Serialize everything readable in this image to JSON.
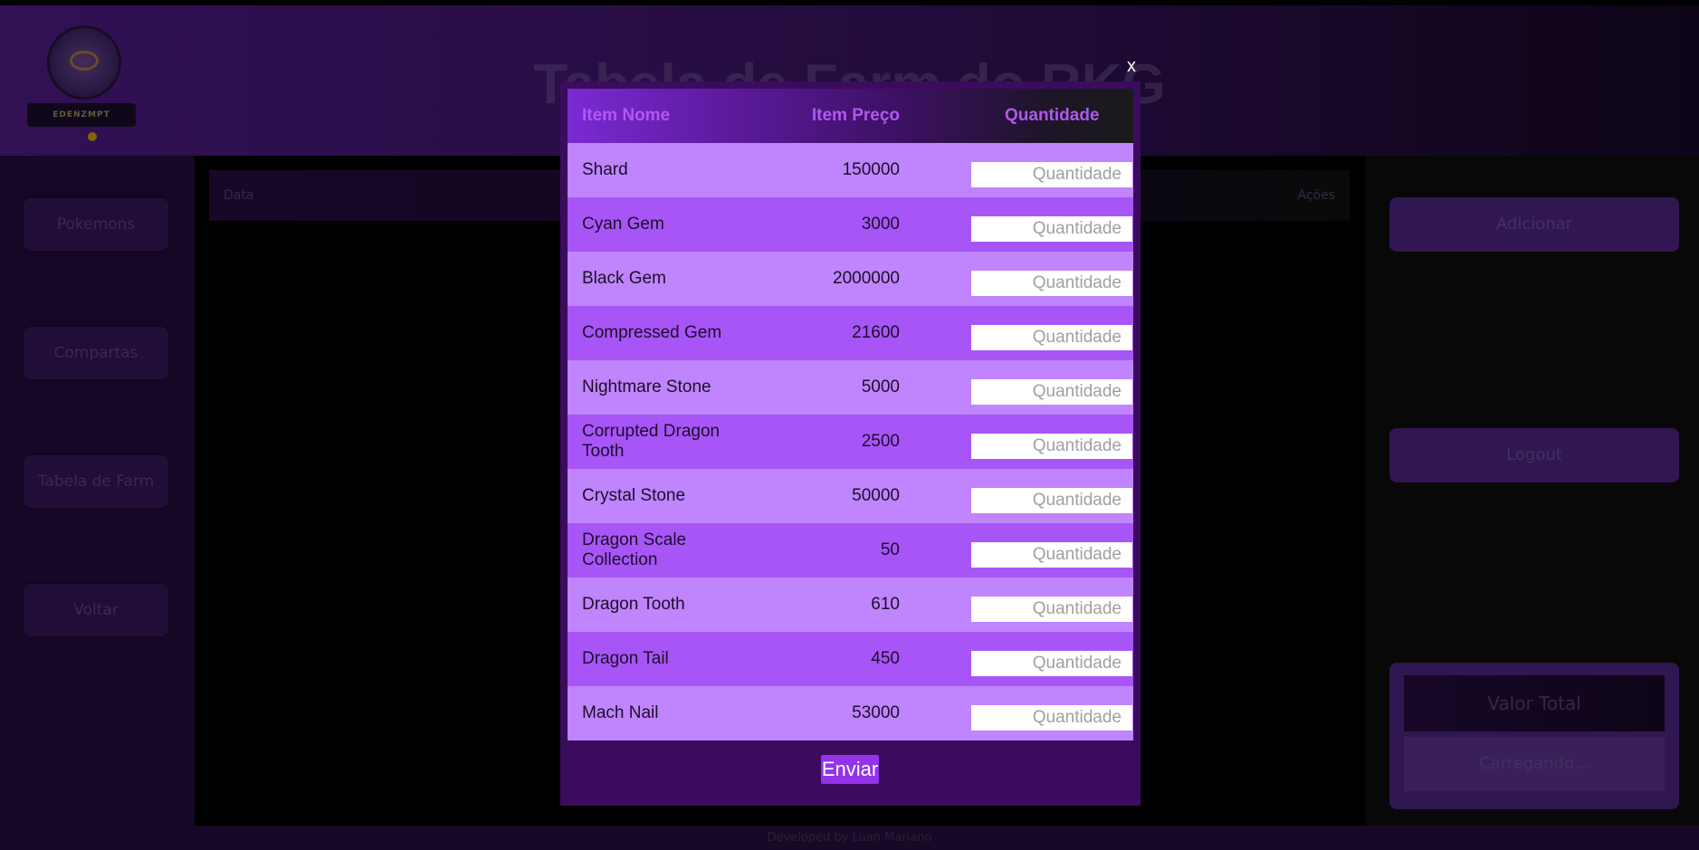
{
  "app": {
    "title": "Tabela de Farm do RKG",
    "logo_text": "EDENZMPT",
    "footer": "Developed by Luan Mariano"
  },
  "sidebar": {
    "items": [
      {
        "label": "Pokemons"
      },
      {
        "label": "Compartas"
      },
      {
        "label": "Tabela de Farm"
      },
      {
        "label": "Voltar"
      }
    ]
  },
  "content": {
    "header_left": "Data",
    "header_right": "Ações"
  },
  "right_panel": {
    "add_label": "Adicionar",
    "logout_label": "Logout",
    "total_label": "Valor Total",
    "total_value": "Carregando..."
  },
  "modal": {
    "close_label": "x",
    "headers": {
      "name": "Item Nome",
      "price": "Item Preço",
      "quantity": "Quantidade"
    },
    "items": [
      {
        "name": "Shard",
        "price": "150000",
        "qty_placeholder": "Quantidade"
      },
      {
        "name": "Cyan Gem",
        "price": "3000",
        "qty_placeholder": "Quantidade"
      },
      {
        "name": "Black Gem",
        "price": "2000000",
        "qty_placeholder": "Quantidade"
      },
      {
        "name": "Compressed Gem",
        "price": "21600",
        "qty_placeholder": "Quantidade"
      },
      {
        "name": "Nightmare Stone",
        "price": "5000",
        "qty_placeholder": "Quantidade"
      },
      {
        "name": "Corrupted Dragon Tooth",
        "price": "2500",
        "qty_placeholder": "Quantidade"
      },
      {
        "name": "Crystal Stone",
        "price": "50000",
        "qty_placeholder": "Quantidade"
      },
      {
        "name": "Dragon Scale Collection",
        "price": "50",
        "qty_placeholder": "Quantidade"
      },
      {
        "name": "Dragon Tooth",
        "price": "610",
        "qty_placeholder": "Quantidade"
      },
      {
        "name": "Dragon Tail",
        "price": "450",
        "qty_placeholder": "Quantidade"
      },
      {
        "name": "Mach Nail",
        "price": "53000",
        "qty_placeholder": "Quantidade"
      }
    ],
    "submit_label": "Enviar"
  },
  "colors": {
    "modal_bg": "#3b0c5e",
    "row_light": "#c084fc",
    "row_dark": "#a855f7",
    "header_text": "#b157f0",
    "submit_button": "#9333ea"
  }
}
